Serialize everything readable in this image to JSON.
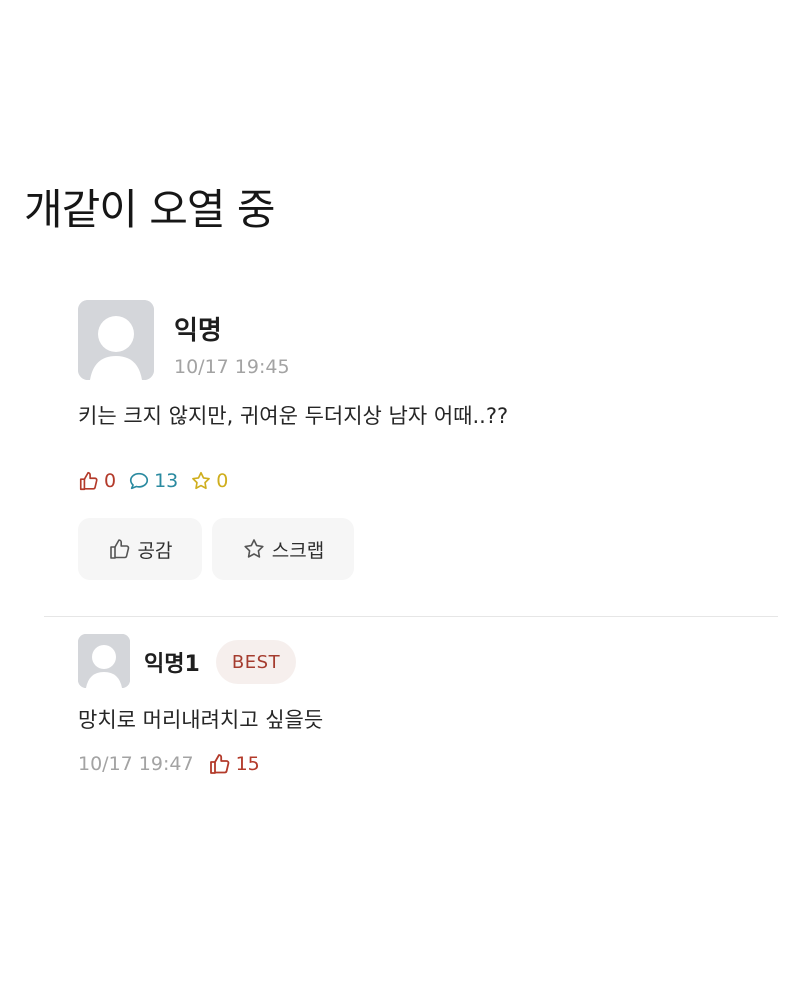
{
  "caption": "개같이 오열 중",
  "post": {
    "author": "익명",
    "time": "10/17 19:45",
    "body": "키는 크지 않지만, 귀여운 두더지상 남자 어때..??",
    "stats": {
      "likes": "0",
      "comments": "13",
      "scraps": "0"
    },
    "buttons": {
      "like": "공감",
      "scrap": "스크랩"
    }
  },
  "comment": {
    "author": "익명1",
    "badge": "BEST",
    "body": "망치로 머리내려치고 싶을듯",
    "time": "10/17 19:47",
    "likes": "15"
  },
  "colors": {
    "like": "#b33a2a",
    "comment": "#2a8aa0",
    "scrap": "#cfae1e",
    "badge_bg": "#f6efed",
    "badge_text": "#a53c2f"
  },
  "icons": {
    "avatar": "default-avatar-icon",
    "like": "thumbs-up-icon",
    "comment": "speech-bubble-icon",
    "scrap": "star-icon"
  }
}
